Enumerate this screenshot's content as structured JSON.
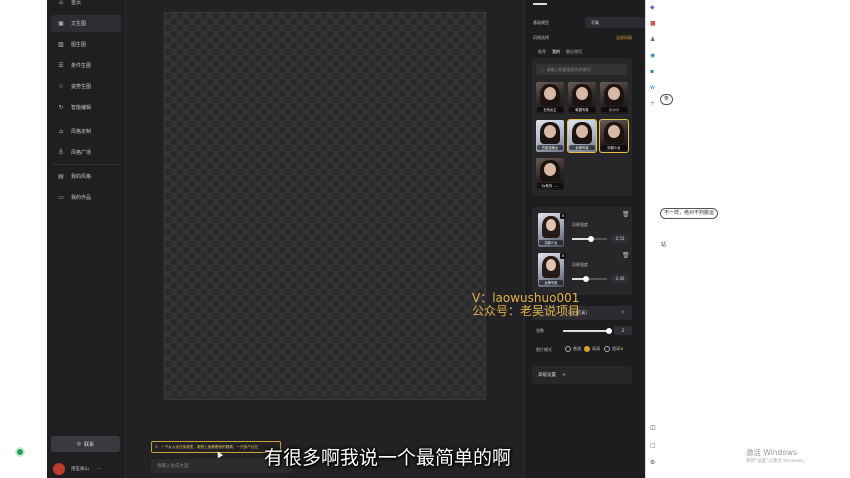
{
  "sidebar": {
    "items": [
      {
        "label": "首页",
        "icon": "home-icon"
      },
      {
        "label": "文生图",
        "icon": "text-image-icon"
      },
      {
        "label": "图生图",
        "icon": "image-icon"
      },
      {
        "label": "条件生图",
        "icon": "sliders-icon"
      },
      {
        "label": "姿势生图",
        "icon": "pose-icon"
      },
      {
        "label": "智能编辑",
        "icon": "magic-icon"
      },
      {
        "label": "风格定制",
        "icon": "style-icon"
      },
      {
        "label": "风格广场",
        "icon": "square-icon"
      },
      {
        "label": "我的风格",
        "icon": "my-style-icon"
      },
      {
        "label": "我的作品",
        "icon": "folder-icon"
      }
    ],
    "active_index": 1,
    "contact_label": "联系",
    "user_name": "南笙阁山",
    "more_label": "···"
  },
  "editor": {
    "tip_text": "一下女人走在街道里，眼镜上面看着她的眼睛，一只多户住在",
    "prompt_placeholder": "请输入生成文案"
  },
  "panel": {
    "model_label": "基础模型",
    "model_value": "写真",
    "style_select_label": "风格选择",
    "all_styles_link": "全部风格",
    "tabs": [
      "推荐",
      "我的",
      "最近使用"
    ],
    "active_tab": 1,
    "search_placeholder": "请输入想要搜索的关键词",
    "style_thumbs": [
      {
        "caption": "日系女主"
      },
      {
        "caption": "韩国写真"
      },
      {
        "caption": "小小小"
      },
      {
        "caption": "古韵游美女"
      },
      {
        "caption": "女神写真"
      },
      {
        "caption": "清新少女"
      },
      {
        "caption": "Sx系列 - ..."
      }
    ],
    "added_styles": [
      {
        "caption": "清新少女",
        "label": "风格强度",
        "value": "0.55",
        "level": 0.55
      },
      {
        "caption": "女神写真",
        "label": "风格强度",
        "value": "0.40",
        "level": 0.4
      }
    ],
    "ratio_value": "2:3 [写真]",
    "count_label": "张数",
    "count_value": "2",
    "count_level": 0.95,
    "mode_label": "图片模式",
    "modes": [
      "普通",
      "高清",
      "超清"
    ],
    "active_mode": 1,
    "advanced_label": "高级设置",
    "advanced_chevron": ">"
  },
  "right_page": {
    "pills": [
      "条",
      "不一样，绝对不判搬运"
    ],
    "fragment": "站",
    "win_activate": "激活 Windows",
    "win_activate_sub": "转到\"设置\"以激活 Windows。"
  },
  "overlay": {
    "watermark_line1": "V：laowushuo001",
    "watermark_line2": "公众号：老吴说项目",
    "subtitle": "有很多啊我说一个最简单的啊"
  },
  "colors": {
    "app_bg": "#1b1b1d",
    "accent": "#e0a033",
    "subtitle": "#ffffff",
    "watermark": "#e2b347"
  }
}
